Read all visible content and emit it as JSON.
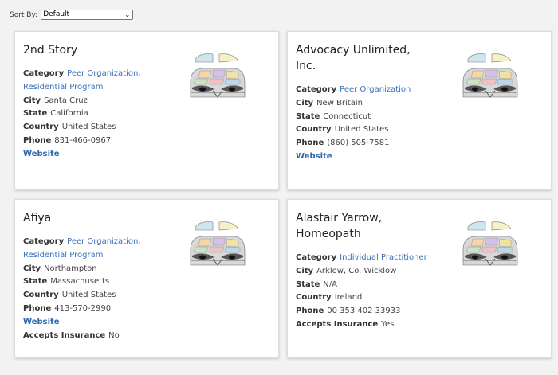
{
  "sort": {
    "label": "Sort By:",
    "value": "Default"
  },
  "labels": {
    "category": "Category",
    "city": "City",
    "state": "State",
    "country": "Country",
    "phone": "Phone",
    "website": "Website",
    "insurance": "Accepts Insurance"
  },
  "cards": [
    {
      "title_line1": "2nd Story",
      "title_line2": "",
      "category1": "Peer Organization,",
      "category2": "Residential Program",
      "city": "Santa Cruz",
      "state": "California",
      "country": "United States",
      "phone": "831-466-0967",
      "insurance": ""
    },
    {
      "title_line1": "Advocacy Unlimited,",
      "title_line2": "Inc.",
      "category1": "Peer Organization",
      "category2": "",
      "city": "New Britain",
      "state": "Connecticut",
      "country": "United States",
      "phone": "(860) 505-7581",
      "insurance": ""
    },
    {
      "title_line1": "Afiya",
      "title_line2": "",
      "category1": "Peer Organization,",
      "category2": "Residential Program",
      "city": "Northampton",
      "state": "Massachusetts",
      "country": "United States",
      "phone": "413-570-2990",
      "insurance": "No"
    },
    {
      "title_line1": "Alastair Yarrow,",
      "title_line2": "Homeopath",
      "category1": "Individual Practitioner",
      "category2": "",
      "city": "Arklow, Co. Wicklow",
      "state": "N/A",
      "country": "Ireland",
      "phone": "00 353 402 33933",
      "insurance": "Yes"
    }
  ]
}
